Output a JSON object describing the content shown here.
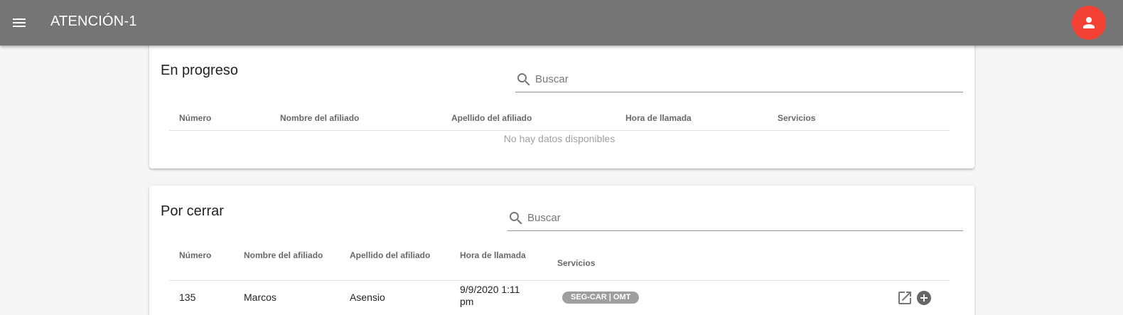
{
  "appbar": {
    "title": "ATENCIÓN-1",
    "menu_icon": "menu-icon",
    "avatar_icon": "person-icon",
    "avatar_color": "#f44336",
    "bar_color": "#757575"
  },
  "in_progress": {
    "title": "En progreso",
    "search_placeholder": "Buscar",
    "columns": [
      "Número",
      "Nombre del afiliado",
      "Apellido del afiliado",
      "Hora de llamada",
      "Servicios"
    ],
    "empty_text": "No hay datos disponibles"
  },
  "to_close": {
    "title": "Por cerrar",
    "search_placeholder": "Buscar",
    "columns": [
      "Número",
      "Nombre del afiliado",
      "Apellido del afiliado",
      "Hora de llamada",
      "Servicios"
    ],
    "rows": [
      {
        "number": "135",
        "first_name": "Marcos",
        "last_name": "Asensio",
        "call_time": "9/9/2020 1:11 pm",
        "services": "SEG-CAR | OMT",
        "actions": [
          "open-in-new-icon",
          "add-circle-icon"
        ]
      }
    ]
  }
}
